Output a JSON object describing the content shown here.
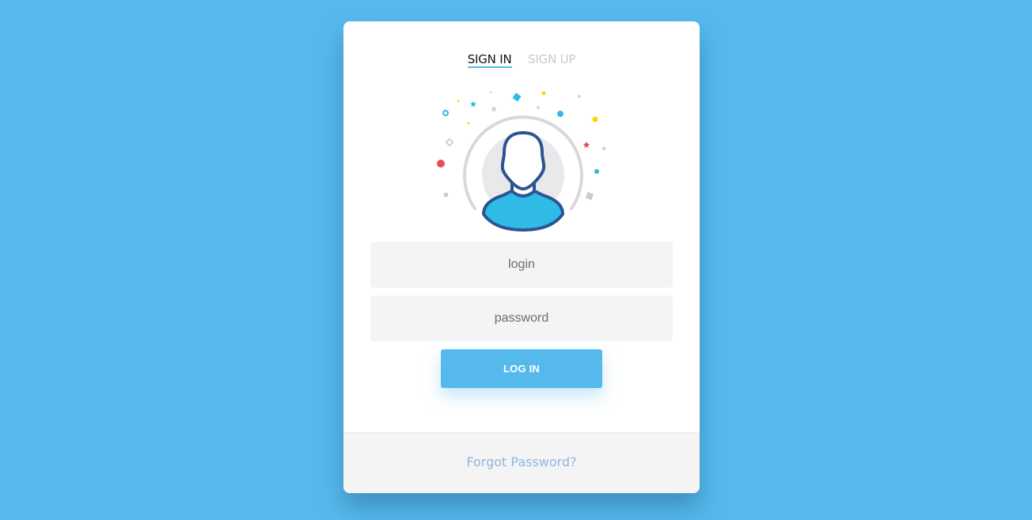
{
  "tabs": {
    "sign_in": "SIGN IN",
    "sign_up": "SIGN UP",
    "active": "sign_in"
  },
  "form": {
    "login_placeholder": "login",
    "login_value": "",
    "password_placeholder": "password",
    "password_value": "",
    "submit_label": "LOG IN"
  },
  "footer": {
    "forgot_password": "Forgot Password?"
  },
  "colors": {
    "background": "#56b9ec",
    "accent": "#56b9ec",
    "avatar_shirt": "#2fbbe6",
    "avatar_outline": "#2b5592",
    "link": "#8fb6e0"
  },
  "icons": {
    "avatar": "user-avatar-icon"
  }
}
